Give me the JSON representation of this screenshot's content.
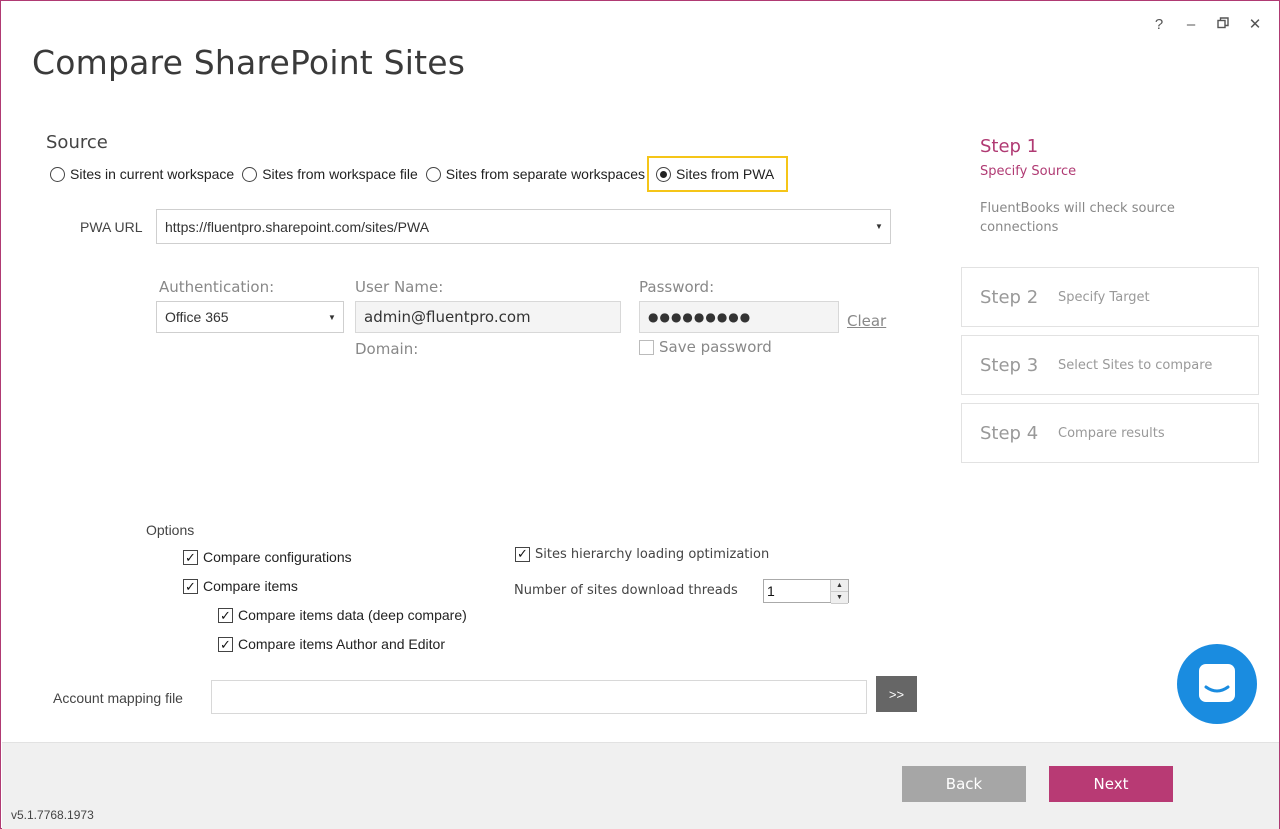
{
  "window": {
    "title": "Compare SharePoint Sites",
    "controls": {
      "help": "?",
      "minimize": "–",
      "restore": "🗗",
      "close": "✕"
    }
  },
  "source": {
    "title": "Source",
    "options": [
      {
        "label": "Sites in current workspace",
        "selected": false
      },
      {
        "label": "Sites from workspace file",
        "selected": false
      },
      {
        "label": "Sites from separate workspaces",
        "selected": false
      },
      {
        "label": "Sites from PWA",
        "selected": true
      }
    ],
    "pwa_url_label": "PWA URL",
    "pwa_url_value": "https://fluentpro.sharepoint.com/sites/PWA",
    "authentication_label": "Authentication:",
    "authentication_value": "Office 365",
    "username_label": "User Name:",
    "username_value": "admin@fluentpro.com",
    "domain_label": "Domain:",
    "password_label": "Password:",
    "password_value": "●●●●●●●●●",
    "clear_label": "Clear",
    "save_password_label": "Save password"
  },
  "options": {
    "title": "Options",
    "compare_configurations": "Compare configurations",
    "compare_items": "Compare items",
    "compare_items_data": "Compare items data (deep compare)",
    "compare_items_author": "Compare items Author and Editor",
    "hierarchy_optimization": "Sites hierarchy loading optimization",
    "threads_label": "Number of sites download threads",
    "threads_value": "1"
  },
  "account_mapping": {
    "label": "Account mapping file",
    "value": "",
    "browse_label": ">>"
  },
  "steps": {
    "active": {
      "number": "Step 1",
      "title": "Specify Source",
      "description": "FluentBooks will check source connections"
    },
    "others": [
      {
        "number": "Step 2",
        "title": "Specify Target"
      },
      {
        "number": "Step 3",
        "title": "Select Sites to compare"
      },
      {
        "number": "Step 4",
        "title": "Compare results"
      }
    ]
  },
  "footer": {
    "back_label": "Back",
    "next_label": "Next",
    "version": "v5.1.7768.1973"
  },
  "colors": {
    "accent": "#b03a73",
    "highlight": "#f5c518",
    "chat": "#1a8ce0",
    "back_button": "#a6a6a6",
    "next_button": "#b83a74"
  }
}
